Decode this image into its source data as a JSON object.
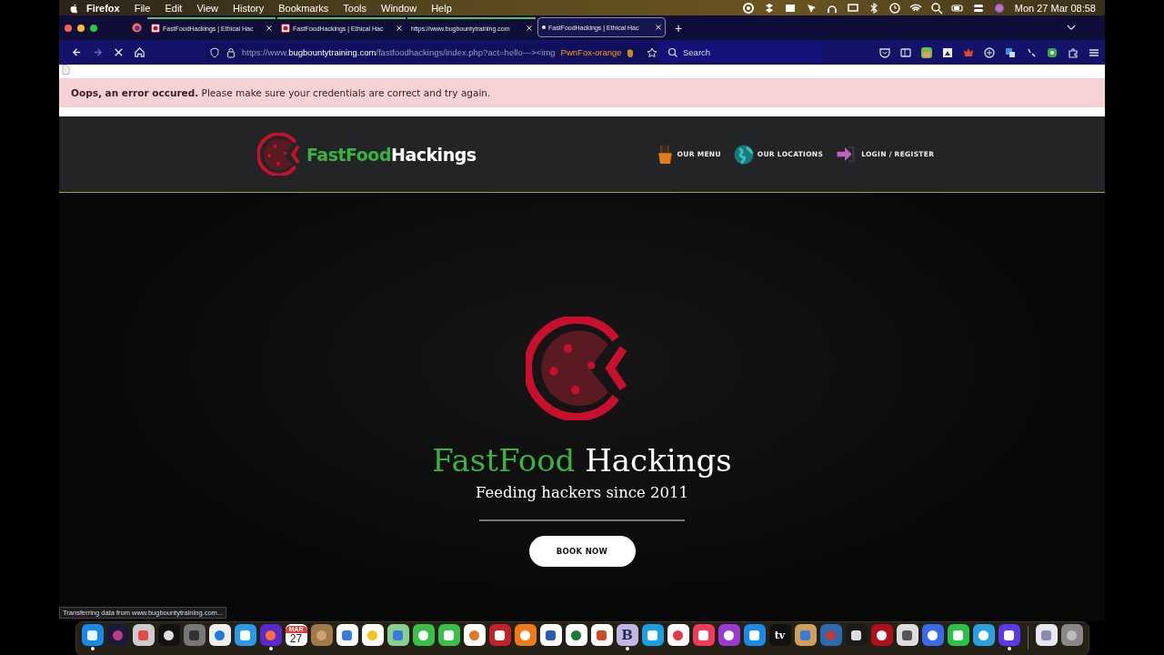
{
  "menu_bar": {
    "app": "Firefox",
    "menus": [
      "File",
      "Edit",
      "View",
      "History",
      "Bookmarks",
      "Tools",
      "Window",
      "Help"
    ],
    "clock": "Mon 27 Mar  08:58"
  },
  "tabs": [
    {
      "kind": "site",
      "title": "FastFoodHackings | Ethical Hac",
      "selected": false,
      "loading": false
    },
    {
      "kind": "site",
      "title": "FastFoodHackings | Ethical Hac",
      "selected": false,
      "loading": false
    },
    {
      "kind": "plain",
      "title": "https://www.bugbountytraining.com",
      "selected": false,
      "loading": false
    },
    {
      "kind": "plain",
      "title": "FastFoodHackings | Ethical Hac",
      "selected": true,
      "loading": true
    }
  ],
  "new_tab": "+",
  "nav_buttons": [
    {
      "kind": "back",
      "disabled": false
    },
    {
      "kind": "forward",
      "disabled": true
    },
    {
      "kind": "stop",
      "disabled": false
    },
    {
      "kind": "home",
      "disabled": false
    }
  ],
  "address_bar": {
    "url_prefix": "https://www.",
    "url_domain": "bugbountytraining.com",
    "url_path": "/fastfoodhackings/index.php?act=hello---><img",
    "container_label": "PwnFox-orange"
  },
  "search": {
    "placeholder": "Search"
  },
  "alert": {
    "message": "**Oops, an error occured.** Please make sure your credentials are correct and try again."
  },
  "site_header": {
    "brand_first": "FastFood",
    "brand_second": "Hackings",
    "nav": [
      {
        "kind": "fries",
        "label": "OUR MENU"
      },
      {
        "kind": "globe",
        "label": "OUR LOCATIONS"
      },
      {
        "kind": "login",
        "label": "LOGIN / REGISTER"
      }
    ]
  },
  "hero": {
    "title_first": "FastFood",
    "title_second": "Hackings",
    "tagline": "Feeding hackers since 2011",
    "button": "BOOK NOW"
  },
  "status": "Transferring data from www.bugbountytraining.com...",
  "dock": [
    {
      "kind": "finder",
      "running": true
    },
    {
      "kind": "siri",
      "running": false
    },
    {
      "kind": "launchpad",
      "running": false
    },
    {
      "kind": "mission",
      "running": false
    },
    {
      "kind": "settings",
      "running": false
    },
    {
      "kind": "safari",
      "running": false
    },
    {
      "kind": "mail",
      "running": false
    },
    {
      "kind": "firefox",
      "running": true
    },
    {
      "kind": "calendar",
      "running": false,
      "month": "MAR",
      "day": "27"
    },
    {
      "kind": "contacts",
      "running": false
    },
    {
      "kind": "reminders",
      "running": false
    },
    {
      "kind": "notes",
      "running": false
    },
    {
      "kind": "maps",
      "running": false
    },
    {
      "kind": "messages",
      "running": false
    },
    {
      "kind": "facetime",
      "running": false
    },
    {
      "kind": "photos",
      "running": false
    },
    {
      "kind": "photobooth",
      "running": false
    },
    {
      "kind": "books",
      "running": false
    },
    {
      "kind": "word",
      "running": false
    },
    {
      "kind": "excel",
      "running": false
    },
    {
      "kind": "powerpoint",
      "running": false
    },
    {
      "kind": "letter",
      "running": true,
      "glyph": "B"
    },
    {
      "kind": "skype",
      "running": false
    },
    {
      "kind": "news",
      "running": false
    },
    {
      "kind": "music",
      "running": false
    },
    {
      "kind": "podcasts",
      "running": false
    },
    {
      "kind": "appstore",
      "running": false
    },
    {
      "kind": "tv",
      "running": false,
      "glyph": "tv"
    },
    {
      "kind": "preview",
      "running": false
    },
    {
      "kind": "vm",
      "running": false
    },
    {
      "kind": "terminal",
      "running": false
    },
    {
      "kind": "ftp",
      "running": false
    },
    {
      "kind": "calculator",
      "running": false
    },
    {
      "kind": "signal",
      "running": false
    },
    {
      "kind": "whatsapp",
      "running": false
    },
    {
      "kind": "telegram",
      "running": false
    },
    {
      "kind": "bolt",
      "running": true
    },
    {
      "kind": "separator"
    },
    {
      "kind": "downloads",
      "running": false
    },
    {
      "kind": "trash",
      "running": false
    }
  ]
}
